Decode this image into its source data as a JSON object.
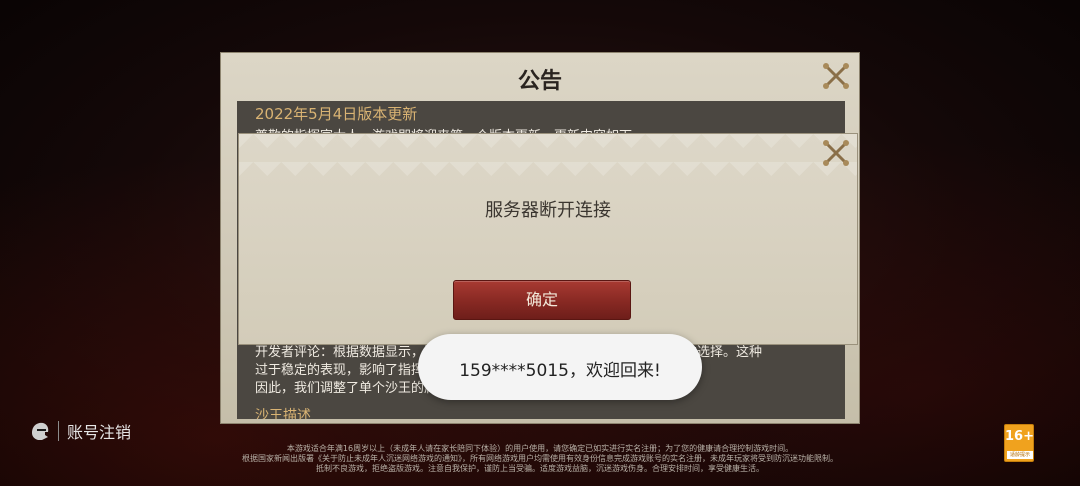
{
  "notice": {
    "title": "公告",
    "header": "2022年5月4日版本更新",
    "line1": "尊敬的指挥官大人，游戏即将迎来第一个版本更新，更新内容如下",
    "line2": "开发者评论：根据数据显示，沙王目前在阵容中出场率偏高，强度略为稳妥的选择。这种",
    "line3": "过于稳定的表现，影响了指挥官的游戏体验",
    "line4": "因此，我们调整了单个沙王的属性数值",
    "footer": "沙王描述"
  },
  "dialog": {
    "message": "服务器断开连接",
    "confirm_label": "确定"
  },
  "toast": {
    "text": "159****5015，欢迎回来!"
  },
  "account": {
    "label": "账号注销"
  },
  "legal": {
    "line1": "本游戏适合年满16周岁以上（未成年人请在家长陪同下体验）的用户使用，请您确定已如实进行实名注册；为了您的健康请合理控制游戏时间。",
    "line2": "根据国家新闻出版署《关于防止未成年人沉迷网络游戏的通知》，所有网络游戏用户均需使用有效身份信息完成游戏账号的实名注册，未成年玩家将受到防沉迷功能限制。",
    "line3": "抵制不良游戏，拒绝盗版游戏。注意自我保护，谨防上当受骗。适度游戏益脑，沉迷游戏伤身。合理安排时间，享受健康生活。"
  },
  "age_rating": {
    "number": "16+",
    "caption": "适龄提示"
  },
  "colors": {
    "confirm_button": "#8a2a24",
    "panel": "#d3ccb9",
    "age_badge": "#f0a21e"
  }
}
